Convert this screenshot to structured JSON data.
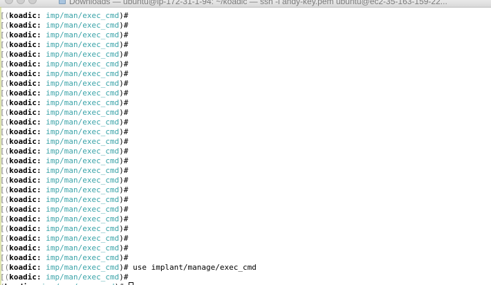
{
  "window": {
    "title": "Downloads — ubuntu@ip-172-31-1-94: ~/koadic — ssh -i andy-key.pem ubuntu@ec2-35-163-159-22..."
  },
  "prompt": {
    "open": "(",
    "name": "koadic:",
    "path": "imp/man/exec_cmd",
    "close": ")#"
  },
  "lines": [
    {
      "bracket": "[",
      "cmd": ""
    },
    {
      "bracket": "[",
      "cmd": ""
    },
    {
      "bracket": "[",
      "cmd": ""
    },
    {
      "bracket": "[",
      "cmd": ""
    },
    {
      "bracket": "[",
      "cmd": ""
    },
    {
      "bracket": "[",
      "cmd": ""
    },
    {
      "bracket": "[",
      "cmd": ""
    },
    {
      "bracket": "[",
      "cmd": ""
    },
    {
      "bracket": "[",
      "cmd": ""
    },
    {
      "bracket": "[",
      "cmd": ""
    },
    {
      "bracket": "[",
      "cmd": ""
    },
    {
      "bracket": "[",
      "cmd": ""
    },
    {
      "bracket": "[",
      "cmd": ""
    },
    {
      "bracket": "[",
      "cmd": ""
    },
    {
      "bracket": "[",
      "cmd": ""
    },
    {
      "bracket": "[",
      "cmd": ""
    },
    {
      "bracket": "[",
      "cmd": ""
    },
    {
      "bracket": "[",
      "cmd": ""
    },
    {
      "bracket": "[",
      "cmd": ""
    },
    {
      "bracket": "[",
      "cmd": ""
    },
    {
      "bracket": "[",
      "cmd": ""
    },
    {
      "bracket": "[",
      "cmd": ""
    },
    {
      "bracket": "[",
      "cmd": ""
    },
    {
      "bracket": "[",
      "cmd": ""
    },
    {
      "bracket": "[",
      "cmd": ""
    },
    {
      "bracket": "[",
      "cmd": ""
    },
    {
      "bracket": "[",
      "cmd": "use implant/manage/exec_cmd"
    },
    {
      "bracket": "[",
      "cmd": ""
    },
    {
      "bracket": "",
      "cmd": "",
      "cursor": true
    }
  ],
  "colors": {
    "prompt_path": "#3aa3a8",
    "prompt_name": "#000000",
    "background": "#ffffff"
  },
  "icons": {
    "folder": "folder-icon",
    "close": "close-icon",
    "minimize": "minimize-icon",
    "maximize": "maximize-icon"
  }
}
